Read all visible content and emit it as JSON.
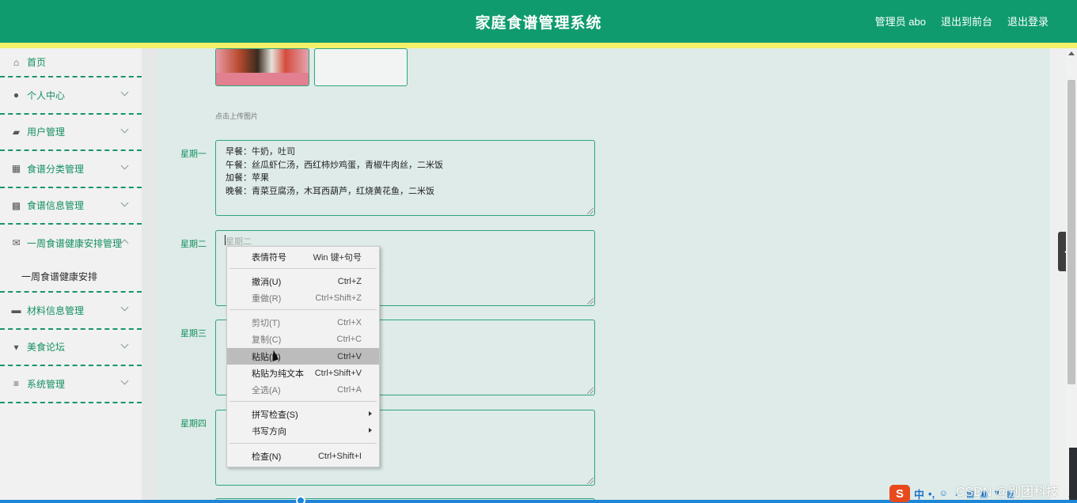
{
  "header": {
    "title": "家庭食谱管理系统",
    "links": [
      "管理员 abo",
      "退出到前台",
      "退出登录"
    ]
  },
  "sidebar": {
    "items": [
      {
        "label": "首页",
        "icon": "home-icon"
      },
      {
        "label": "个人中心",
        "icon": "user-icon"
      },
      {
        "label": "用户管理",
        "icon": "users-icon"
      },
      {
        "label": "食谱分类管理",
        "icon": "grid-icon"
      },
      {
        "label": "食谱信息管理",
        "icon": "apps-icon"
      },
      {
        "label": "一周食谱健康安排管理",
        "icon": "mail-icon",
        "expanded": true
      },
      {
        "label": "材料信息管理",
        "icon": "briefcase-icon"
      },
      {
        "label": "美食论坛",
        "icon": "sign-icon"
      },
      {
        "label": "系统管理",
        "icon": "list-icon"
      }
    ],
    "subitem": "一周食谱健康安排"
  },
  "form": {
    "upload_hint": "点击上传图片",
    "days": [
      {
        "label": "星期一",
        "lines": [
          "早餐：牛奶，吐司",
          "午餐：丝瓜虾仁汤，西红柿炒鸡蛋，青椒牛肉丝，二米饭",
          "加餐：苹果",
          "晚餐：青菜豆腐汤，木耳西葫芦，红烧黄花鱼，二米饭"
        ]
      },
      {
        "label": "星期二",
        "placeholder": "星期二"
      },
      {
        "label": "星期三",
        "placeholder": ""
      },
      {
        "label": "星期四",
        "placeholder": ""
      }
    ]
  },
  "context_menu": {
    "items": [
      {
        "label": "表情符号",
        "shortcut": "Win 键+句号",
        "enabled": true
      },
      {
        "label": "撤消(U)",
        "shortcut": "Ctrl+Z",
        "enabled": true
      },
      {
        "label": "重做(R)",
        "shortcut": "Ctrl+Shift+Z",
        "enabled": false
      },
      {
        "label": "剪切(T)",
        "shortcut": "Ctrl+X",
        "enabled": false
      },
      {
        "label": "复制(C)",
        "shortcut": "Ctrl+C",
        "enabled": false
      },
      {
        "label": "粘贴(P)",
        "shortcut": "Ctrl+V",
        "enabled": true,
        "highlighted": true
      },
      {
        "label": "粘贴为纯文本",
        "shortcut": "Ctrl+Shift+V",
        "enabled": true
      },
      {
        "label": "全选(A)",
        "shortcut": "Ctrl+A",
        "enabled": false
      },
      {
        "label": "拼写检查(S)",
        "shortcut": "",
        "enabled": true,
        "submenu": true
      },
      {
        "label": "书写方向",
        "shortcut": "",
        "enabled": true,
        "submenu": true
      },
      {
        "label": "检查(N)",
        "shortcut": "Ctrl+Shift+I",
        "enabled": true
      }
    ]
  },
  "ime": {
    "logo": "S",
    "mode": "中",
    "punct": "•,"
  },
  "watermark": "CSDN @别团科技",
  "colors": {
    "primary": "#0f9b6e",
    "accent_yellow": "#f3f06a",
    "content_bg": "#deebe8"
  }
}
